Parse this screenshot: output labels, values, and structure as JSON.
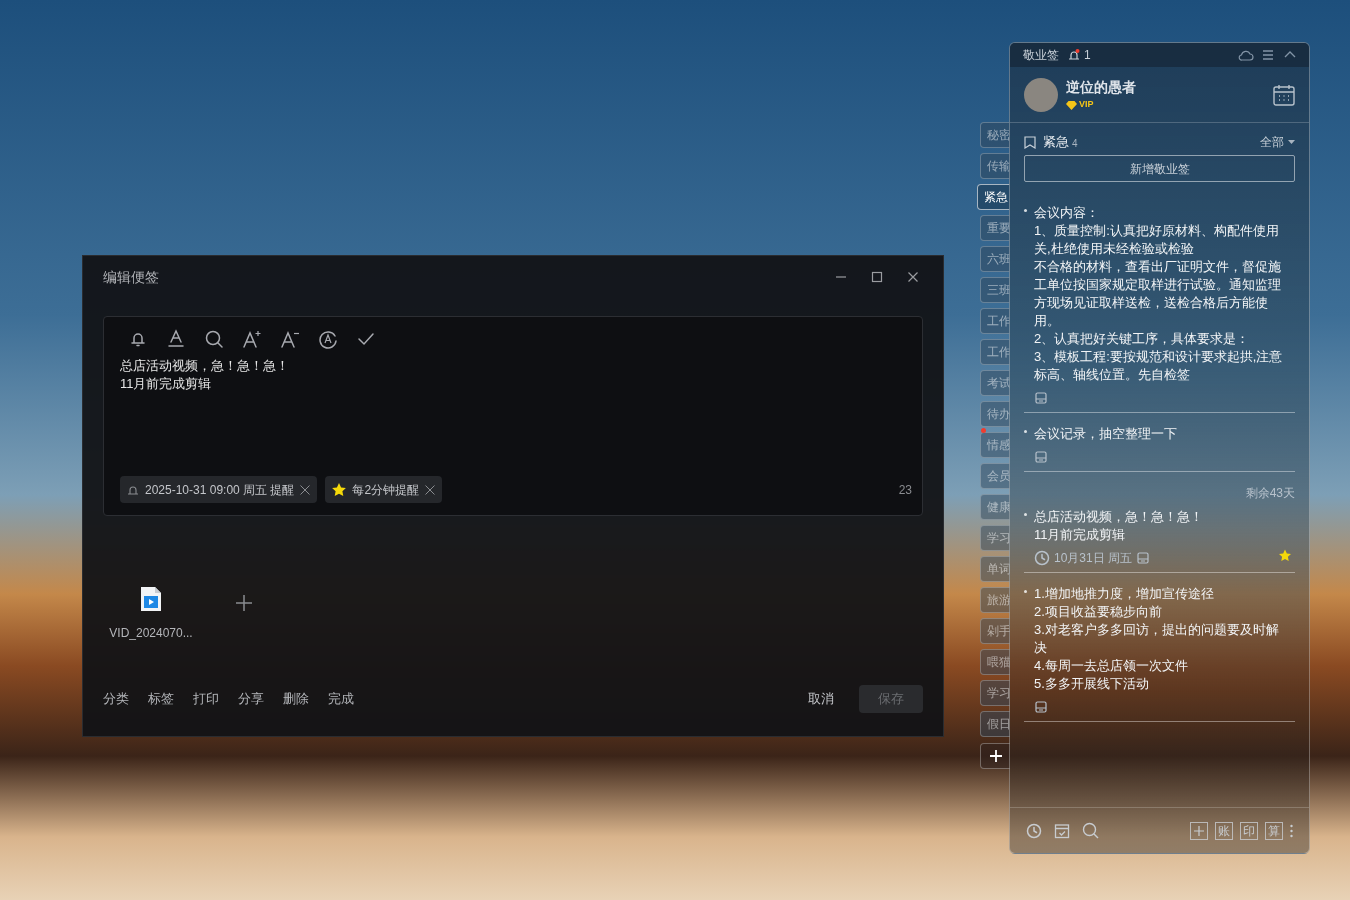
{
  "editor_window": {
    "title": "编辑便签",
    "content": [
      "总店活动视频，急！急！急！",
      "11月前完成剪辑"
    ],
    "tags": [
      {
        "kind": "reminder",
        "text": "2025-10-31 09:00 周五 提醒"
      },
      {
        "kind": "starred",
        "text": "每2分钟提醒"
      }
    ],
    "char_count": "23",
    "attachments": [
      {
        "name": "VID_2024070..."
      }
    ],
    "actions": [
      "分类",
      "标签",
      "打印",
      "分享",
      "删除",
      "完成"
    ],
    "cancel": "取消",
    "save": {
      "label": "保存",
      "disabled": true
    }
  },
  "panel": {
    "app_name": "敬业签",
    "notification_count": "1",
    "user": {
      "name": "逆位的愚者",
      "badge": "VIP"
    },
    "category": {
      "name": "紧急",
      "count": "4"
    },
    "filter": "全部",
    "new_button": "新增敬业签",
    "notes": [
      {
        "lines": [
          "会议内容：",
          "1、质量控制:认真把好原材料、构配件使用关,杜绝使用未经检验或检验",
          "不合格的材料，查看出厂证明文件，督促施工单位按国家规定取样进行试验。通知监理方现场见证取样送检，送检合格后方能使用。",
          "2、认真把好关键工序，具体要求是：",
          "3、模板工程:要按规范和设计要求起拱,注意标高、轴线位置。先自检签"
        ],
        "starred": false
      },
      {
        "lines": [
          "会议记录，抽空整理一下"
        ],
        "starred": false
      },
      {
        "remaining": "剩余43天",
        "lines": [
          "总店活动视频，急！急！急！",
          "11月前完成剪辑"
        ],
        "date": "10月31日 周五",
        "starred": true
      },
      {
        "lines": [
          "1.增加地推力度，增加宣传途径",
          "2.项目收益要稳步向前",
          "3.对老客户多多回访，提出的问题要及时解决",
          "4.每周一去总店领一次文件",
          "5.多多开展线下活动"
        ],
        "starred": false
      }
    ],
    "bottom_buttons": [
      "账",
      "印",
      "算"
    ],
    "side_tabs": [
      {
        "label": "秘密",
        "selected": false,
        "unread": false
      },
      {
        "label": "传输",
        "selected": false,
        "unread": false
      },
      {
        "label": "紧急",
        "selected": true,
        "unread": false
      },
      {
        "label": "重要",
        "selected": false,
        "unread": false
      },
      {
        "label": "六班",
        "selected": false,
        "unread": false
      },
      {
        "label": "三班",
        "selected": false,
        "unread": false
      },
      {
        "label": "工作",
        "selected": false,
        "unread": false
      },
      {
        "label": "工作",
        "selected": false,
        "unread": false
      },
      {
        "label": "考试",
        "selected": false,
        "unread": false
      },
      {
        "label": "待办",
        "selected": false,
        "unread": false
      },
      {
        "label": "情感",
        "selected": false,
        "unread": true
      },
      {
        "label": "会员",
        "selected": false,
        "unread": false
      },
      {
        "label": "健康",
        "selected": false,
        "unread": false
      },
      {
        "label": "学习",
        "selected": false,
        "unread": false
      },
      {
        "label": "单词",
        "selected": false,
        "unread": false
      },
      {
        "label": "旅游",
        "selected": false,
        "unread": false
      },
      {
        "label": "剁手",
        "selected": false,
        "unread": false
      },
      {
        "label": "喂猫",
        "selected": false,
        "unread": false
      },
      {
        "label": "学习",
        "selected": false,
        "unread": false
      },
      {
        "label": "假日",
        "selected": false,
        "unread": false
      }
    ]
  }
}
